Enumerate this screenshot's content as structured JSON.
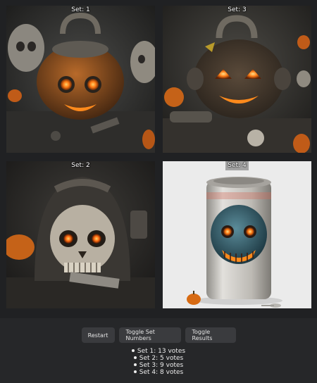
{
  "gallery": {
    "tiles": [
      {
        "label": "Set: 1"
      },
      {
        "label": "Set: 3"
      },
      {
        "label": "Set: 2"
      },
      {
        "label": "Set: 4"
      }
    ]
  },
  "controls": {
    "restart_label": "Restart",
    "toggle_set_numbers_label": "Toggle Set Numbers",
    "toggle_results_label": "Toggle Results"
  },
  "results": [
    "Set 1: 13 votes",
    "Set 2: 5 votes",
    "Set 3: 9 votes",
    "Set 4: 8 votes"
  ],
  "colors": {
    "page_bg": "#262729",
    "button_bg": "#3a3b3e",
    "pumpkin_orange": "#d9731f",
    "eye_glow": "#ff8a1c",
    "can_bg": "#e9e9e9"
  }
}
